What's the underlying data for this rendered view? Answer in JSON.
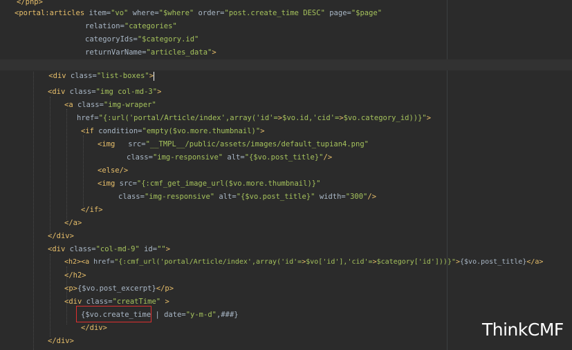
{
  "watermark": "ThinkCMF",
  "lines": [
    {
      "text": "</php>"
    },
    {
      "text": "<portal:articles item=\"vo\" where=\"$where\" order=\"post.create_time DESC\" page=\"$page\""
    },
    {
      "text": "relation=\"categories\""
    },
    {
      "text": "categoryIds=\"$category.id\""
    },
    {
      "text": "returnVarName=\"articles_data\">"
    },
    {
      "text": "<div class=\"list-boxes\">"
    },
    {
      "text": ""
    },
    {
      "text": "<div class=\"img col-md-3\">"
    },
    {
      "text": "<a class=\"img-wraper\""
    },
    {
      "text": "href=\"{:url('portal/Article/index',array('id'=>$vo.id,'cid'=>$vo.category_id))}\">"
    },
    {
      "text": "<if condition=\"empty($vo.more.thumbnail)\">"
    },
    {
      "text": "<img   src=\"__TMPL__/public/assets/images/default_tupian4.png\""
    },
    {
      "text": "class=\"img-responsive\" alt=\"{$vo.post_title}\"/>"
    },
    {
      "text": "<else/>"
    },
    {
      "text": "<img src=\"{:cmf_get_image_url($vo.more.thumbnail)}\""
    },
    {
      "text": "class=\"img-responsive\" alt=\"{$vo.post_title}\" width=\"300\"/>"
    },
    {
      "text": "</if>"
    },
    {
      "text": "</a>"
    },
    {
      "text": "</div>"
    },
    {
      "text": "<div class=\"col-md-9\" id=\"\">"
    },
    {
      "text": "<h2><a href=\"{:cmf_url('portal/Article/index',array('id'=>$vo['id'],'cid'=>$category['id']))}\">{$vo.post_title}</a>"
    },
    {
      "text": "</h2>"
    },
    {
      "text": "<p>{$vo.post_excerpt}</p>"
    },
    {
      "text": "<div class=\"creatTime\" >"
    },
    {
      "text": "{$vo.create_time | date=\"y-m-d\",###}"
    },
    {
      "text": "</div>"
    },
    {
      "text": "</div>"
    }
  ]
}
